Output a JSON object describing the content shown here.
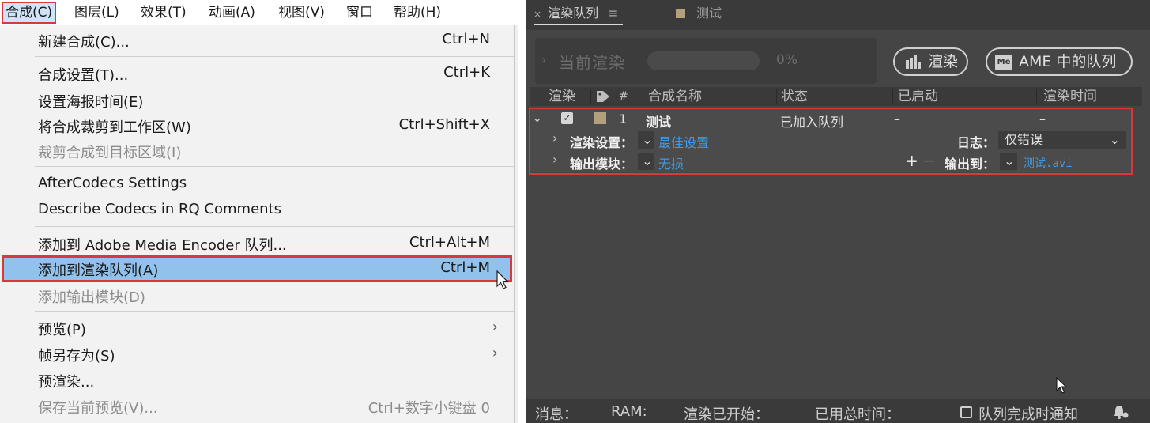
{
  "menubar": {
    "items": [
      "合成(C)",
      "图层(L)",
      "效果(T)",
      "动画(A)",
      "视图(V)",
      "窗口",
      "帮助(H)"
    ]
  },
  "composition_menu": {
    "items": [
      {
        "label": "新建合成(C)...",
        "shortcut": "Ctrl+N"
      },
      {
        "label": "合成设置(T)...",
        "shortcut": "Ctrl+K"
      },
      {
        "label": "设置海报时间(E)",
        "shortcut": ""
      },
      {
        "label": "将合成裁剪到工作区(W)",
        "shortcut": "Ctrl+Shift+X"
      },
      {
        "label": "裁剪合成到目标区域(I)",
        "shortcut": ""
      },
      {
        "label": "AfterCodecs Settings",
        "shortcut": ""
      },
      {
        "label": "Describe Codecs in RQ Comments",
        "shortcut": ""
      },
      {
        "label": "添加到 Adobe Media Encoder 队列...",
        "shortcut": "Ctrl+Alt+M"
      },
      {
        "label": "添加到渲染队列(A)",
        "shortcut": "Ctrl+M"
      },
      {
        "label": "添加输出模块(D)",
        "shortcut": ""
      },
      {
        "label": "预览(P)",
        "shortcut": "›"
      },
      {
        "label": "帧另存为(S)",
        "shortcut": "›"
      },
      {
        "label": "预渲染...",
        "shortcut": ""
      },
      {
        "label": "保存当前预览(V)...",
        "shortcut": "Ctrl+数字小键盘 0"
      }
    ]
  },
  "render_queue": {
    "tabs": {
      "active": "渲染队列",
      "close": "×",
      "menu": "≡",
      "other": "测试"
    },
    "current_render_label": "当前渲染",
    "progress_percent": "0%",
    "progress_value": 0,
    "render_button": "渲染",
    "ame_button": "AME 中的队列",
    "ame_icon_text": "Me",
    "columns": {
      "render": "渲染",
      "num": "#",
      "comp_name": "合成名称",
      "status": "状态",
      "started": "已启动",
      "render_time": "渲染时间"
    },
    "item": {
      "index": "1",
      "name": "测试",
      "status": "已加入队列",
      "started": "–",
      "render_time": "–"
    },
    "render_settings_label": "渲染设置：",
    "render_settings_value": "最佳设置",
    "log_label": "日志：",
    "log_value": "仅错误",
    "output_module_label": "输出模块：",
    "output_module_value": "无损",
    "output_to_label": "输出到：",
    "output_to_value": "测试.avi"
  },
  "status_bar": {
    "messages": "消息：",
    "ram": "RAM:",
    "render_started": "渲染已开始：",
    "total_time": "已用总时间：",
    "notify": "队列完成时通知"
  },
  "colors": {
    "highlight": "#90c2ec",
    "callout": "#d9383c",
    "link": "#3f9ae8",
    "panel_bg": "#454545"
  }
}
